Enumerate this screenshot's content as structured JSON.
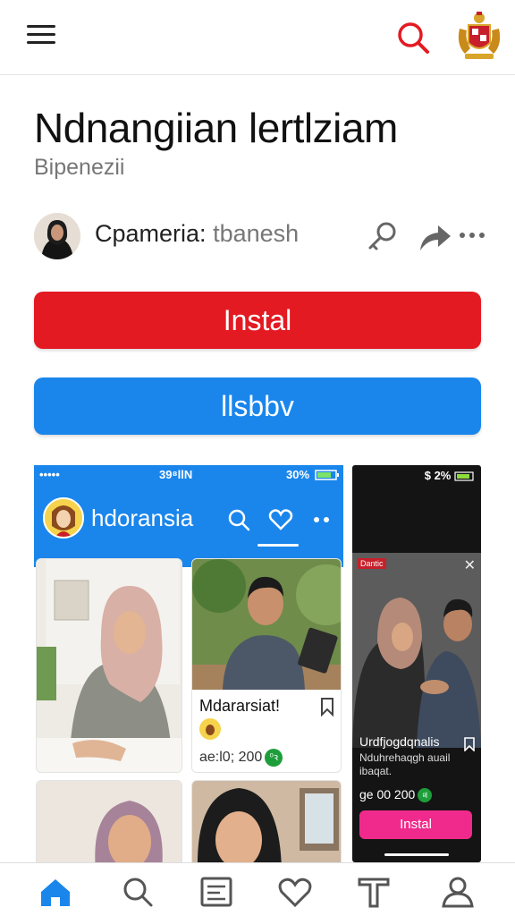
{
  "topbar": {
    "menu_icon": "hamburger-menu-icon",
    "search_icon": "search-icon",
    "logo_icon": "crest-logo-icon",
    "accent": "#e41a22"
  },
  "header": {
    "title": "Ndnangiian lertlziam",
    "subtitle": "Bipenezii"
  },
  "author": {
    "name": "Cpameria:",
    "handle": "tbanesh",
    "actions": [
      "key-icon",
      "share-icon",
      "more-icon"
    ]
  },
  "buttons": {
    "primary_label": "Instal",
    "primary_color": "#e41a22",
    "secondary_label": "llsbbv",
    "secondary_color": "#1a86ec"
  },
  "phone": {
    "status_left": "•••••",
    "status_center": "39⁸llN",
    "status_right": "30%",
    "brand": "hdoransia",
    "header_color": "#1a86ec",
    "cards": [
      {
        "title": "",
        "meta": ""
      },
      {
        "title": "Mdararsiat!",
        "meta": "ae:l0; 200",
        "badge": "⁰ꝛ"
      },
      {
        "title": "",
        "meta": ""
      },
      {
        "title": "",
        "meta": ""
      }
    ]
  },
  "promo": {
    "status": "$ 2%",
    "tag": "Dantic",
    "title": "Urdfjogdqnalis",
    "description": "Nduhrehaqgh auail ibaqat.",
    "price": "ge 00 200",
    "badge": "ᵍl",
    "button_label": "Instal",
    "button_color": "#f02a8c"
  },
  "bottom_nav": {
    "items": [
      "home-icon",
      "search-icon",
      "list-icon",
      "heart-icon",
      "text-icon",
      "profile-icon"
    ],
    "active_color": "#1a86ec"
  }
}
